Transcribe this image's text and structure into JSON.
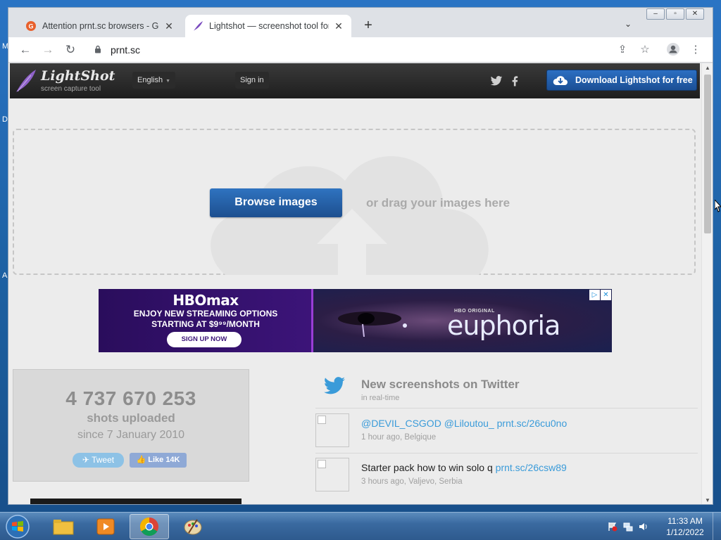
{
  "browser": {
    "tabs": [
      {
        "title": "Attention prnt.sc browsers - Gen",
        "active": false
      },
      {
        "title": "Lightshot — screenshot tool for M",
        "active": true
      }
    ],
    "url": "prnt.sc"
  },
  "lightshot": {
    "logo_name": "LightShot",
    "logo_tagline": "screen capture tool",
    "language": "English",
    "sign_in": "Sign in",
    "download": "Download Lightshot for free",
    "browse": "Browse images",
    "drag": "or drag your images here"
  },
  "ad": {
    "brand": "HBOmax",
    "line1": "ENJOY NEW STREAMING OPTIONS",
    "line2": "STARTING AT $9⁹⁹/MONTH",
    "cta": "SIGN UP NOW",
    "tag": "HBO ORIGINAL",
    "show": "euphoria"
  },
  "stats": {
    "count": "4 737 670 253",
    "label": "shots uploaded",
    "since": "since 7 January 2010",
    "tweet": "Tweet",
    "like": "Like 14K"
  },
  "feed": {
    "title": "New screenshots on Twitter",
    "subtitle": "in real-time",
    "items": [
      {
        "text": "@DEVIL_CSGOD @Liloutou_ ",
        "link": "prnt.sc/26cu0no",
        "meta": "1 hour ago, Belgique",
        "all_link": true
      },
      {
        "text": "Starter pack how to win solo q ",
        "link": "prnt.sc/26csw89",
        "meta": "3 hours ago, Valjevo, Serbia",
        "all_link": false
      }
    ]
  },
  "desktop": {
    "letters": [
      "M",
      "D",
      "A"
    ]
  },
  "taskbar": {
    "time": "11:33 AM",
    "date": "1/12/2022"
  }
}
